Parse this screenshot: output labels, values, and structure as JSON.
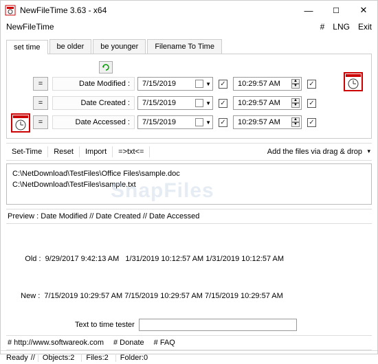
{
  "window": {
    "title": "NewFileTime 3.63 - x64"
  },
  "menubar": {
    "app": "NewFileTime",
    "hash": "#",
    "lng": "LNG",
    "exit": "Exit"
  },
  "tabs": {
    "set_time": "set time",
    "be_older": "be older",
    "be_younger": "be younger",
    "filename_to_time": "Filename To Time"
  },
  "fields": {
    "modified": {
      "label": "Date Modified :",
      "date": "7/15/2019",
      "time": "10:29:57 AM"
    },
    "created": {
      "label": "Date Created :",
      "date": "7/15/2019",
      "time": "10:29:57 AM"
    },
    "accessed": {
      "label": "Date Accessed :",
      "date": "7/15/2019",
      "time": "10:29:57 AM"
    }
  },
  "toolbar": {
    "set_time": "Set-Time",
    "reset": "Reset",
    "import": "Import",
    "txt": "=>txt<=",
    "dragdrop": "Add the files via drag & drop"
  },
  "files": {
    "f1": "C:\\NetDownload\\TestFiles\\Office Files\\sample.doc",
    "f2": "C:\\NetDownload\\TestFiles\\sample.txt"
  },
  "preview": {
    "header": "Preview  :   Date Modified    //   Date Created    //   Date Accessed",
    "old": "     Old :  9/29/2017 9:42:13 AM   1/31/2019 10:12:57 AM 1/31/2019 10:12:57 AM",
    "new": "   New :  7/15/2019 10:29:57 AM 7/15/2019 10:29:57 AM 7/15/2019 10:29:57 AM"
  },
  "tester": {
    "label": "Text to time tester"
  },
  "links": {
    "site": "# http://www.softwareok.com",
    "donate": "# Donate",
    "faq": "# FAQ"
  },
  "status": {
    "ready": "Ready",
    "objects": "Objects:2",
    "files": "Files:2",
    "folder": "Folder:0"
  }
}
